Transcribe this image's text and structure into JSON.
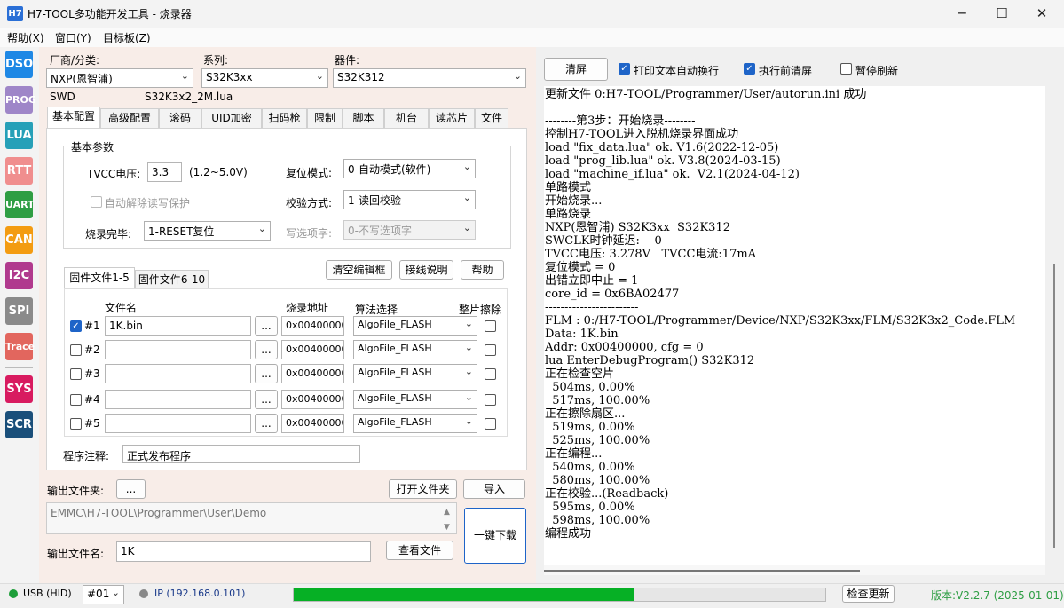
{
  "window": {
    "app_icon": "H7",
    "title": "H7-TOOL多功能开发工具 - 烧录器",
    "minimize": "─",
    "maximize": "☐",
    "close": "✕"
  },
  "menu": [
    "帮助(X)",
    "窗口(Y)",
    "目标板(Z)"
  ],
  "sidebar": [
    {
      "label": "DSO",
      "color": "#1e88e5"
    },
    {
      "label": "PROG",
      "color": "#9e86c8"
    },
    {
      "label": "LUA",
      "color": "#26a0b8"
    },
    {
      "label": "RTT",
      "color": "#f08e8e"
    },
    {
      "label": "UART",
      "color": "#2e9e44"
    },
    {
      "label": "CAN",
      "color": "#f39c12"
    },
    {
      "label": "I2C",
      "color": "#b03a8e"
    },
    {
      "label": "SPI",
      "color": "#8a8a8a"
    },
    {
      "label": "Trace",
      "color": "#e2665e"
    },
    {
      "label": "SYS",
      "color": "#d81b60"
    },
    {
      "label": "SCR",
      "color": "#1a4f7a"
    }
  ],
  "vendor": {
    "label": "厂商/分类:",
    "value": "NXP(恩智浦)"
  },
  "series": {
    "label": "系列:",
    "value": "S32K3xx"
  },
  "device": {
    "label": "器件:",
    "value": "S32K312"
  },
  "interface": "SWD",
  "lua_file": "S32K3x2_2M.lua",
  "tabs": [
    "基本配置",
    "高级配置",
    "滚码",
    "UID加密",
    "扫码枪",
    "限制",
    "脚本",
    "机台",
    "读芯片",
    "文件"
  ],
  "basic": {
    "group": "基本参数",
    "tvcc_label": "TVCC电压:",
    "tvcc_value": "3.3",
    "tvcc_range": "(1.2~5.0V)",
    "reset_label": "复位模式:",
    "reset_value": "0-自动模式(软件)",
    "unlock": "自动解除读写保护",
    "verify_label": "校验方式:",
    "verify_value": "1-读回校验",
    "done_label": "烧录完毕:",
    "done_value": "1-RESET复位",
    "wp_label": "写选项字:",
    "wp_value": "0-不写选项字"
  },
  "fw_tabs": [
    "固件文件1-5",
    "固件文件6-10"
  ],
  "fw_buttons": {
    "clear": "清空编辑框",
    "wiring": "接线说明",
    "help": "帮助"
  },
  "fw_headers": {
    "name": "文件名",
    "addr": "烧录地址",
    "algo": "算法选择",
    "erase": "整片擦除"
  },
  "fw_rows": [
    {
      "id": "#1",
      "checked": true,
      "file": "1K.bin",
      "browse": "...",
      "addr": "0x00400000",
      "algo": "AlgoFile_FLASH"
    },
    {
      "id": "#2",
      "checked": false,
      "file": "",
      "browse": "...",
      "addr": "0x00400000",
      "algo": "AlgoFile_FLASH"
    },
    {
      "id": "#3",
      "checked": false,
      "file": "",
      "browse": "...",
      "addr": "0x00400000",
      "algo": "AlgoFile_FLASH"
    },
    {
      "id": "#4",
      "checked": false,
      "file": "",
      "browse": "...",
      "addr": "0x00400000",
      "algo": "AlgoFile_FLASH"
    },
    {
      "id": "#5",
      "checked": false,
      "file": "",
      "browse": "...",
      "addr": "0x00400000",
      "algo": "AlgoFile_FLASH"
    }
  ],
  "note": {
    "label": "程序注释:",
    "value": "正式发布程序"
  },
  "output": {
    "folder_label": "输出文件夹:",
    "browse": "...",
    "open_folder": "打开文件夹",
    "import": "导入",
    "path": "EMMC\\H7-TOOL\\Programmer\\User\\Demo",
    "name_label": "输出文件名:",
    "name_value": "1K",
    "view_file": "查看文件",
    "download": "一键下载"
  },
  "right_toolbar": {
    "clear": "清屏",
    "auto_wrap": "打印文本自动换行",
    "clear_before": "执行前清屏",
    "pause": "暂停刷新"
  },
  "console_lines": [
    "更新文件 0:H7-TOOL/Programmer/User/autorun.ini 成功",
    "",
    "--------第3步：开始烧录--------",
    "控制H7-TOOL进入脱机烧录界面成功",
    "load \"fix_data.lua\" ok. V1.6(2022-12-05)",
    "load \"prog_lib.lua\" ok. V3.8(2024-03-15)",
    "load \"machine_if.lua\" ok.  V2.1(2024-04-12)",
    "单路模式",
    "开始烧录...",
    "单路烧录",
    "NXP(恩智浦) S32K3xx  S32K312",
    "SWCLK时钟延迟:    0",
    "TVCC电压: 3.278V   TVCC电流:17mA",
    "复位模式 = 0",
    "出错立即中止 = 1",
    "core_id = 0x6BA02477",
    "------------------------",
    "FLM : 0:/H7-TOOL/Programmer/Device/NXP/S32K3xx/FLM/S32K3x2_Code.FLM",
    "Data: 1K.bin",
    "Addr: 0x00400000, cfg = 0",
    "lua EnterDebugProgram() S32K312",
    "正在检查空片",
    "  504ms, 0.00%",
    "  517ms, 100.00%",
    "正在擦除扇区...",
    "  519ms, 0.00%",
    "  525ms, 100.00%",
    "正在编程...",
    "  540ms, 0.00%",
    "  580ms, 100.00%",
    "正在校验...(Readback)",
    "  595ms, 0.00%",
    "  598ms, 100.00%",
    "编程成功"
  ],
  "status": {
    "usb": "USB (HID)",
    "port": "#01",
    "ip": "IP (192.168.0.101)",
    "progress": 0.64,
    "update": "检查更新",
    "version": "版本:V2.2.7 (2025-01-01)"
  }
}
